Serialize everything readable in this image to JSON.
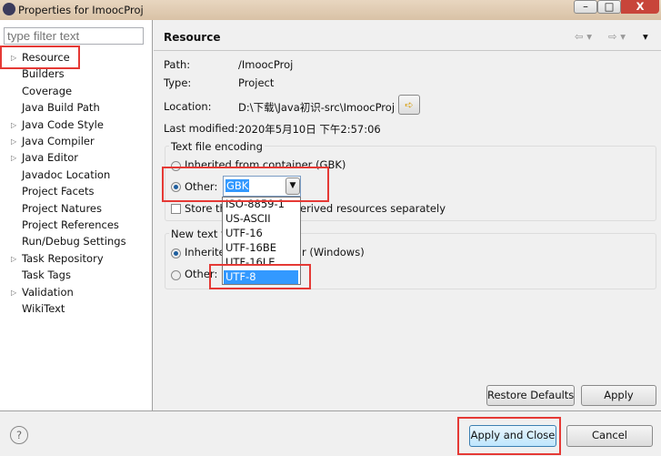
{
  "window": {
    "title": "Properties for ImoocProj"
  },
  "filter": {
    "placeholder": "type filter text"
  },
  "tree": [
    {
      "label": "Resource",
      "expandable": true
    },
    {
      "label": "Builders"
    },
    {
      "label": "Coverage"
    },
    {
      "label": "Java Build Path"
    },
    {
      "label": "Java Code Style",
      "expandable": true
    },
    {
      "label": "Java Compiler",
      "expandable": true
    },
    {
      "label": "Java Editor",
      "expandable": true
    },
    {
      "label": "Javadoc Location"
    },
    {
      "label": "Project Facets"
    },
    {
      "label": "Project Natures"
    },
    {
      "label": "Project References"
    },
    {
      "label": "Run/Debug Settings"
    },
    {
      "label": "Task Repository",
      "expandable": true
    },
    {
      "label": "Task Tags"
    },
    {
      "label": "Validation",
      "expandable": true
    },
    {
      "label": "WikiText"
    }
  ],
  "page": {
    "title": "Resource",
    "path_label": "Path:",
    "path": "/ImoocProj",
    "type_label": "Type:",
    "type": "Project",
    "location_label": "Location:",
    "location": "D:\\下载\\Java初识-src\\ImoocProj",
    "modified_label": "Last modified:",
    "modified": "2020年5月10日 下午2:57:06"
  },
  "encoding": {
    "group": "Text file encoding",
    "inherited": "Inherited from container (GBK)",
    "other": "Other:",
    "value": "GBK",
    "store_a": "Store th",
    "store_b": "erived resources separately",
    "options": [
      "ISO-8859-1",
      "US-ASCII",
      "UTF-16",
      "UTF-16BE",
      "UTF-16LE",
      "UTF-8"
    ],
    "selected": "UTF-8"
  },
  "delimiter": {
    "group": "New text fi",
    "inherited_a": "Inherite",
    "inherited_b": "r (Windows)",
    "other": "Other:"
  },
  "buttons": {
    "restore": "Restore Defaults",
    "apply": "Apply",
    "apply_close": "Apply and Close",
    "cancel": "Cancel"
  }
}
